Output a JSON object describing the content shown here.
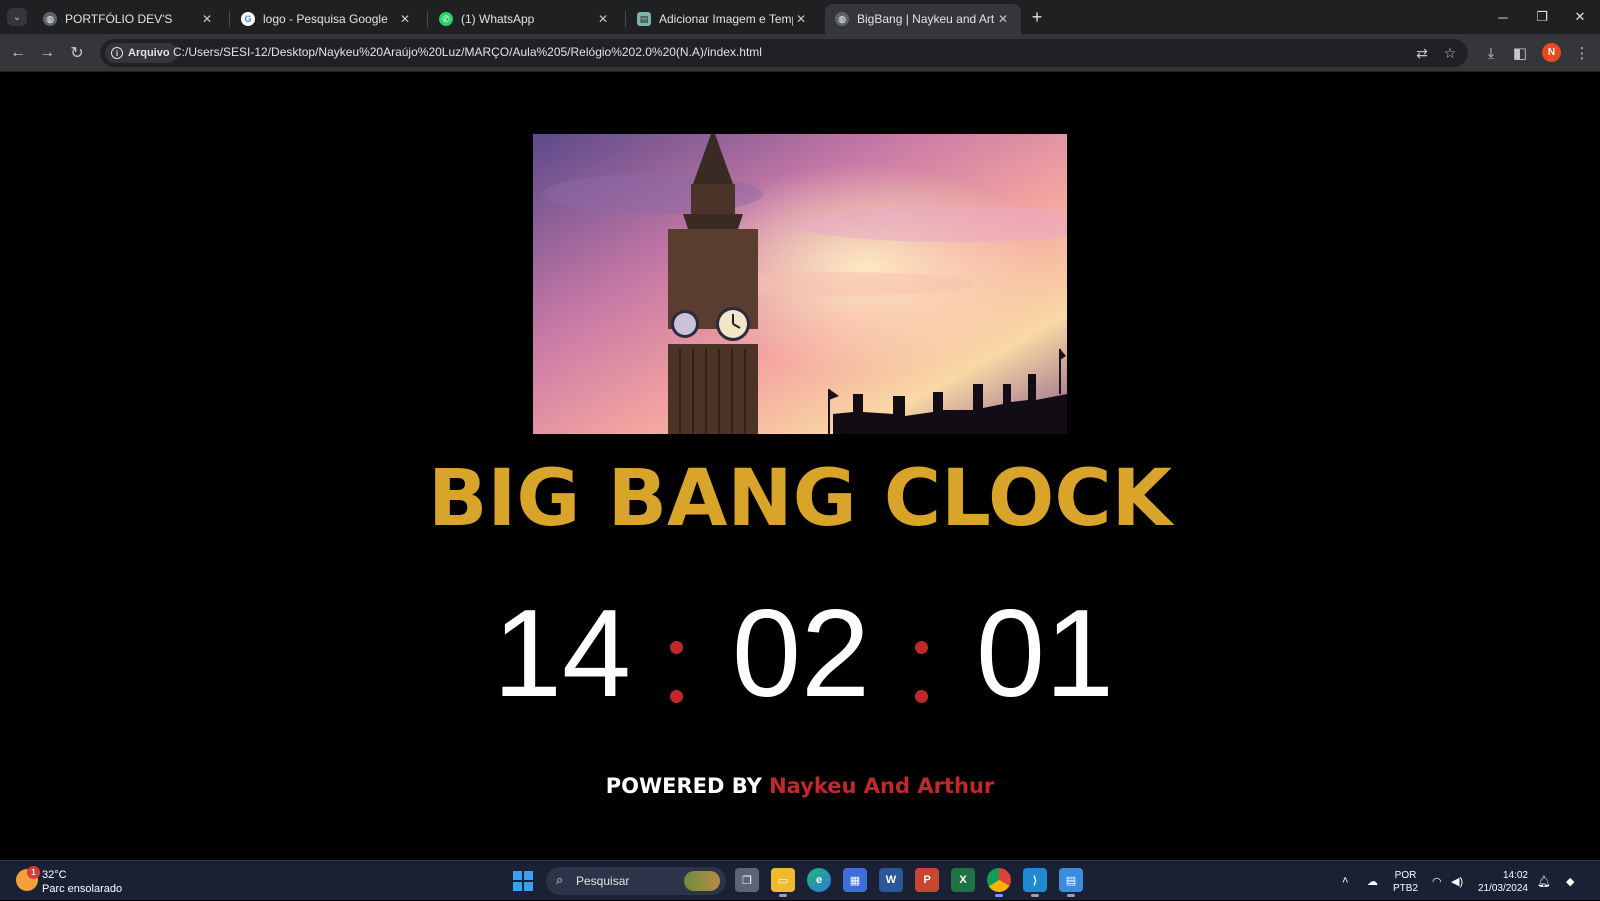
{
  "browser": {
    "tabs": [
      {
        "title": "PORTFÓLIO DEV'S",
        "favicon": "globe-icon",
        "active": false
      },
      {
        "title": "logo - Pesquisa Google",
        "favicon": "google-icon",
        "active": false
      },
      {
        "title": "(1) WhatsApp",
        "favicon": "whatsapp-icon",
        "active": false
      },
      {
        "title": "Adicionar Imagem e Tempo",
        "favicon": "doc-icon",
        "active": false
      },
      {
        "title": "BigBang | Naykeu and Arthur",
        "favicon": "globe-icon",
        "active": true
      }
    ],
    "address": {
      "chip_label": "Arquivo",
      "url": "C:/Users/SESI-12/Desktop/Naykeu%20Araújo%20Luz/MARÇO/Aula%205/Relógio%202.0%20(N.A)/index.html"
    },
    "profile_initial": "N"
  },
  "page": {
    "title": "BIG BANG CLOCK",
    "clock": {
      "hours": "14",
      "minutes": "02",
      "seconds": "01"
    },
    "powered_lead": "POWERED BY",
    "powered_names": "Naykeu And Arthur"
  },
  "taskbar": {
    "weather": {
      "temp": "32°C",
      "desc": "Parc ensolarado",
      "badge": "1"
    },
    "search_placeholder": "Pesquisar",
    "lang_line1": "POR",
    "lang_line2": "PTB2",
    "time": "14:02",
    "date": "21/03/2024"
  },
  "colors": {
    "title_gold": "#d9a42a",
    "accent_red": "#c0282a",
    "background": "#000000"
  }
}
